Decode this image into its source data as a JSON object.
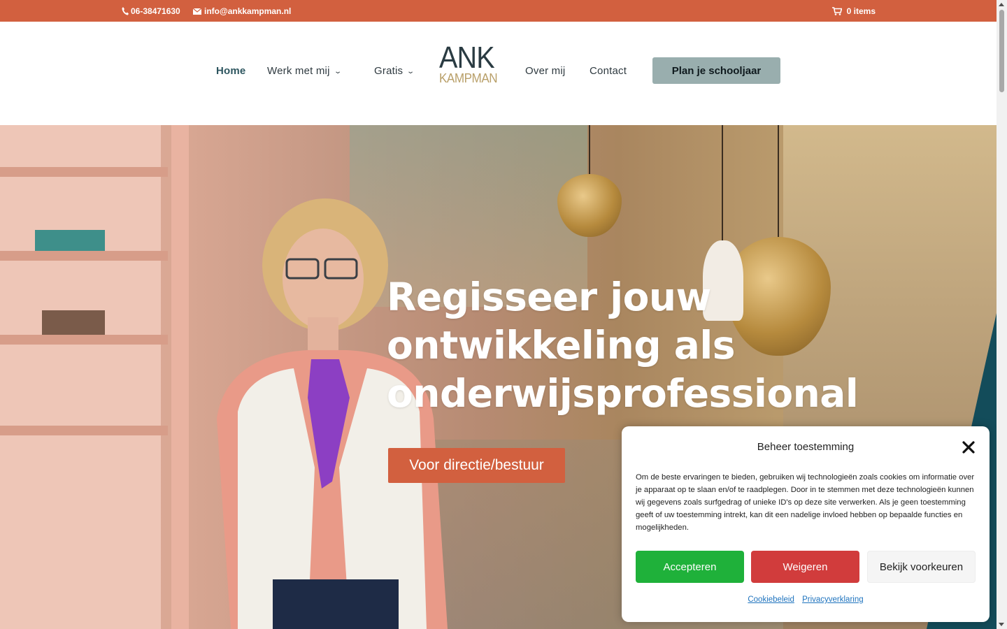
{
  "topbar": {
    "phone": "06-38471630",
    "email": "info@ankkampman.nl",
    "cart": "0 items",
    "phone_icon": "phone-icon",
    "email_icon": "envelope-icon",
    "cart_icon": "cart-icon"
  },
  "nav": {
    "home": "Home",
    "werk": "Werk met mij",
    "gratis": "Gratis",
    "over": "Over mij",
    "contact": "Contact",
    "cta": "Plan je schooljaar"
  },
  "logo": {
    "line1": "ANK",
    "line2": "KAMPMAN"
  },
  "hero": {
    "title_line1": "Regisseer jouw",
    "title_line2": "ontwikkeling als",
    "title_line3": "onderwijsprofessional",
    "button": "Voor directie/bestuur"
  },
  "cookie": {
    "title": "Beheer toestemming",
    "body": "Om de beste ervaringen te bieden, gebruiken wij technologieën zoals cookies om informatie over je apparaat op te slaan en/of te raadplegen. Door in te stemmen met deze technologieën kunnen wij gegevens zoals surfgedrag of unieke ID's op deze site verwerken. Als je geen toestemming geeft of uw toestemming intrekt, kan dit een nadelige invloed hebben op bepaalde functies en mogelijkheden.",
    "accept": "Accepteren",
    "deny": "Weigeren",
    "prefs": "Bekijk voorkeuren",
    "link_cookie": "Cookiebeleid",
    "link_privacy": "Privacyverklaring"
  },
  "colors": {
    "brand_orange": "#d2603f",
    "cta_grey": "#99aeae",
    "accept_green": "#1fb13a",
    "deny_red": "#d13c3c"
  }
}
